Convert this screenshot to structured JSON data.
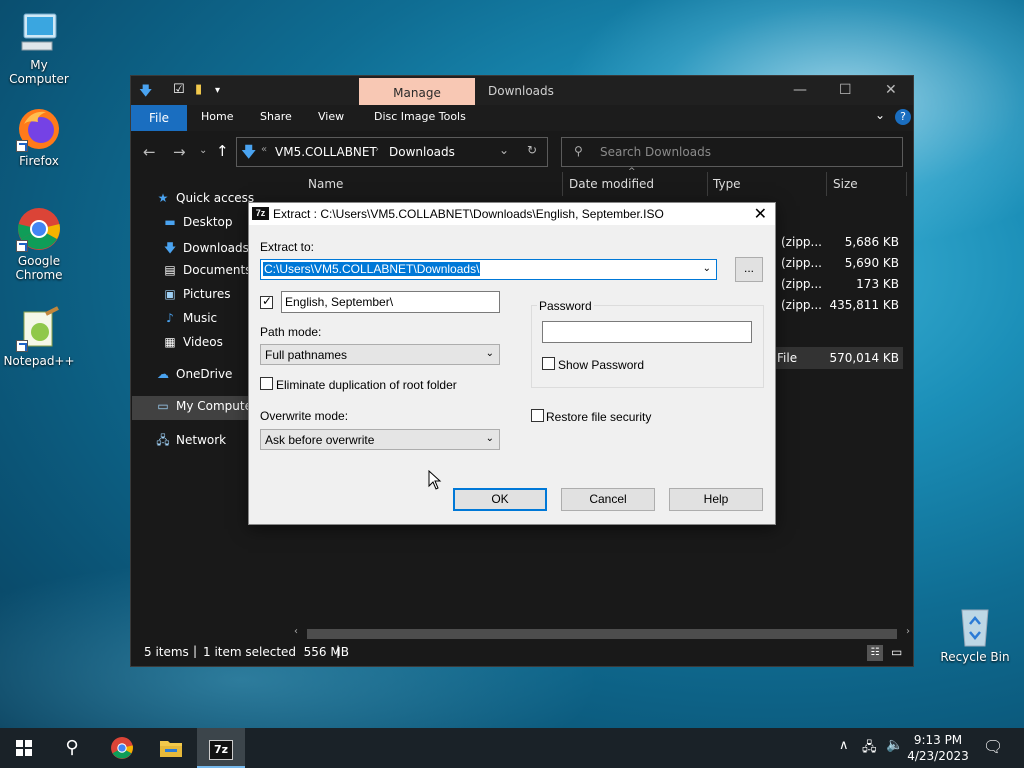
{
  "desktop": {
    "icons": [
      {
        "label": "My Computer"
      },
      {
        "label": "Firefox"
      },
      {
        "label": "Google Chrome"
      },
      {
        "label": "Notepad++"
      },
      {
        "label": "Recycle Bin"
      }
    ]
  },
  "explorer": {
    "manage_tab": "Manage",
    "title": "Downloads",
    "ribbon_tabs": [
      "File",
      "Home",
      "Share",
      "View",
      "Disc Image Tools"
    ],
    "breadcrumb": [
      "VM5.COLLABNET",
      "Downloads"
    ],
    "search_placeholder": "Search Downloads",
    "sidebar": [
      "Quick access",
      "Desktop",
      "Downloads",
      "Documents",
      "Pictures",
      "Music",
      "Videos",
      "OneDrive",
      "My Computer",
      "Network"
    ],
    "columns": [
      "Name",
      "Date modified",
      "Type",
      "Size"
    ],
    "rows": [
      {
        "type": "(zipp...",
        "size": "5,686 KB"
      },
      {
        "type": "(zipp...",
        "size": "5,690 KB"
      },
      {
        "type": "(zipp...",
        "size": "173 KB"
      },
      {
        "type": "(zipp...",
        "size": "435,811 KB"
      },
      {
        "type": "File",
        "size": "570,014 KB"
      }
    ],
    "status": {
      "items": "5 items",
      "selected": "1 item selected  556 MB"
    }
  },
  "dialog": {
    "title": "Extract : C:\\Users\\VM5.COLLABNET\\Downloads\\English, September.ISO",
    "extract_to_label": "Extract to:",
    "extract_to_value": "C:\\Users\\VM5.COLLABNET\\Downloads\\",
    "browse_label": "...",
    "subfolder_value": "English, September\\",
    "path_mode_label": "Path mode:",
    "path_mode_value": "Full pathnames",
    "eliminate_label": "Eliminate duplication of root folder",
    "overwrite_label": "Overwrite mode:",
    "overwrite_value": "Ask before overwrite",
    "password_label": "Password",
    "show_password_label": "Show Password",
    "restore_label": "Restore file security",
    "ok_label": "OK",
    "cancel_label": "Cancel",
    "help_label": "Help"
  },
  "taskbar": {
    "time": "9:13 PM",
    "date": "4/23/2023"
  }
}
